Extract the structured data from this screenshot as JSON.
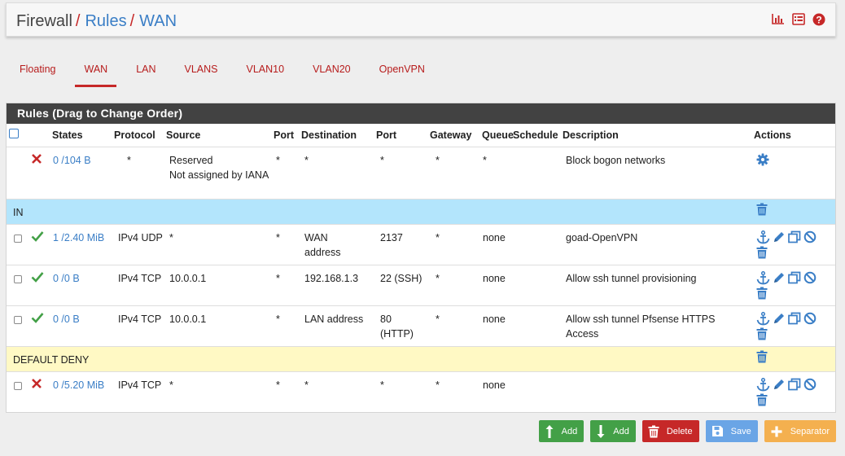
{
  "breadcrumb": {
    "section": "Firewall",
    "page": "Rules",
    "iface": "WAN",
    "sep": "/"
  },
  "tabs": [
    "Floating",
    "WAN",
    "LAN",
    "VLANS",
    "VLAN10",
    "VLAN20",
    "OpenVPN"
  ],
  "active_tab": "WAN",
  "panel": {
    "title": "Rules (Drag to Change Order)"
  },
  "columns": {
    "states": "States",
    "protocol": "Protocol",
    "source": "Source",
    "port": "Port",
    "destination": "Destination",
    "dport": "Port",
    "gateway": "Gateway",
    "queue": "Queue",
    "schedule": "Schedule",
    "description": "Description",
    "actions": "Actions"
  },
  "rules": [
    {
      "states": "0 /104 B",
      "protocol": "*",
      "source": "Reserved\nNot assigned by IANA",
      "port": "*",
      "destination": "*",
      "dport": "*",
      "gateway": "*",
      "queue": "*",
      "schedule": "",
      "description": "Block bogon networks"
    },
    {
      "states": "1 /2.40 MiB",
      "protocol": "IPv4 UDP",
      "source": "*",
      "port": "*",
      "destination": "WAN address",
      "dport": "2137",
      "gateway": "*",
      "queue": "none",
      "schedule": "",
      "description": "goad-OpenVPN"
    },
    {
      "states": "0 /0 B",
      "protocol": "IPv4 TCP",
      "source": "10.0.0.1",
      "port": "*",
      "destination": "192.168.1.3",
      "dport": "22 (SSH)",
      "gateway": "*",
      "queue": "none",
      "schedule": "",
      "description": "Allow ssh tunnel provisioning"
    },
    {
      "states": "0 /0 B",
      "protocol": "IPv4 TCP",
      "source": "10.0.0.1",
      "port": "*",
      "destination": "LAN address",
      "dport": "80 (HTTP)",
      "gateway": "*",
      "queue": "none",
      "schedule": "",
      "description": "Allow ssh tunnel Pfsense HTTPS Access"
    },
    {
      "states": "0 /5.20 MiB",
      "protocol": "IPv4 TCP",
      "source": "*",
      "port": "*",
      "destination": "*",
      "dport": "*",
      "gateway": "*",
      "queue": "none",
      "schedule": "",
      "description": ""
    }
  ],
  "separators": {
    "in": "IN",
    "default_deny": "DEFAULT DENY"
  },
  "buttons": {
    "add_top": "Add",
    "add_bottom": "Add",
    "delete": "Delete",
    "save": "Save",
    "separator": "Separator"
  },
  "colors": {
    "accent_red": "#c62828",
    "link_blue": "#3a7ec6",
    "pass_green": "#43a047",
    "separator_blue": "#b3e5fc",
    "separator_yellow": "#fff9c4"
  }
}
